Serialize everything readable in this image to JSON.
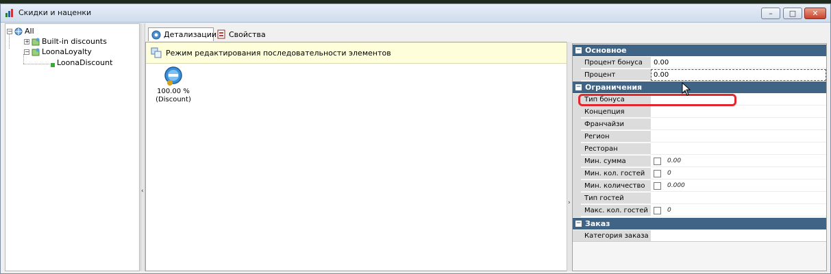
{
  "window": {
    "title": "Скидки и наценки",
    "controls": {
      "minimize": "–",
      "maximize": "□",
      "close": "✕"
    }
  },
  "tree": {
    "root": {
      "label": "All",
      "expanded": true
    },
    "items": [
      {
        "label": "Built-in discounts",
        "expanded": false
      },
      {
        "label": "LoonaLoyalty",
        "expanded": true
      },
      {
        "label": "LoonaDiscount"
      }
    ]
  },
  "tabs": [
    {
      "label": "Детализации",
      "active": true,
      "icon": "details-icon"
    },
    {
      "label": "Свойства",
      "active": false,
      "icon": "properties-icon"
    }
  ],
  "center": {
    "info_text": "Режим редактирования последовательности элементов",
    "discount": {
      "value": "100.00 %",
      "name": "(Discount)"
    }
  },
  "properties": {
    "categories": [
      {
        "label": "Основное",
        "rows": [
          {
            "name": "Процент бонуса",
            "value": "0.00"
          },
          {
            "name": "Процент",
            "value": "0.00"
          }
        ]
      },
      {
        "label": "Ограничения",
        "rows": [
          {
            "name": "Тип бонуса",
            "value": ""
          },
          {
            "name": "Концепция",
            "value": ""
          },
          {
            "name": "Франчайзи",
            "value": ""
          },
          {
            "name": "Регион",
            "value": ""
          },
          {
            "name": "Ресторан",
            "value": ""
          },
          {
            "name": "Мин. сумма",
            "value": "0.00",
            "checkbox": true
          },
          {
            "name": "Мин. кол. гостей",
            "value": "0",
            "checkbox": true
          },
          {
            "name": "Мин. количество",
            "value": "0.000",
            "checkbox": true
          },
          {
            "name": "Тип гостей",
            "value": ""
          },
          {
            "name": "Макс. кол. гостей",
            "value": "0",
            "checkbox": true
          }
        ]
      },
      {
        "label": "Заказ",
        "rows": [
          {
            "name": "Категория заказа",
            "value": ""
          }
        ]
      }
    ]
  },
  "colors": {
    "category_header": "#3f6486",
    "info_bar": "#fefedb",
    "highlight": "#e0262e"
  }
}
